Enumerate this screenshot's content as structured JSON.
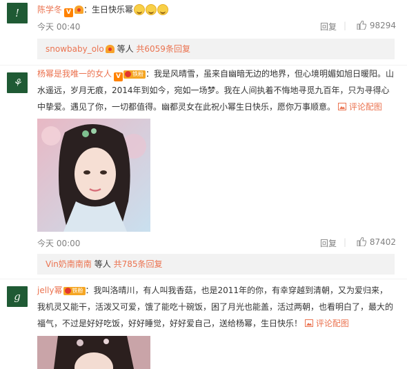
{
  "comments": [
    {
      "avatar_glyph": "!",
      "user": "陈学冬",
      "text": "：生日快乐幂",
      "time": "今天 00:40",
      "reply_label": "回复",
      "likes": "98294",
      "subreply": {
        "user": "snowbaby_olo",
        "middle": "等人",
        "link": "共6059条回复"
      }
    },
    {
      "avatar_glyph": "⚘",
      "user": "杨幂是我唯一的女人",
      "fan_badge": "铁粉",
      "text": "：我是风晴雪，虽来自幽暗无边的地界，但心境明媚如旭日暖阳。山水遥远，岁月无痕，2014年到如今，宛如一场梦。我在人间执着不悔地寻觅九百年，只为寻得心中挚爱。遇见了你，一切都值得。幽都灵女在此祝小幂生日快乐，愿你万事顺意。",
      "pic_comment_label": "评论配图",
      "time": "今天 00:00",
      "reply_label": "回复",
      "likes": "87402",
      "subreply": {
        "user": "Vin奶南南南",
        "middle": "等人",
        "link": "共785条回复"
      }
    },
    {
      "avatar_glyph": "g",
      "user": "jelly幂",
      "fan_badge": "铁粉",
      "text": "：我叫洛晴川，有人叫我香菇，也是2011年的你，有幸穿越到清朝，又为爱归来，我机灵又能干，活泼又可爱，饿了能吃十碗饭，困了月光也能盖，活过两朝，也看明白了，最大的福气，不过是好好吃饭，好好睡觉，好好爱自己，送给杨幂，生日快乐！",
      "pic_comment_label": "评论配图"
    }
  ],
  "colors": {
    "username": "#eb7350",
    "meta": "#808080",
    "subreply_bg": "#f2f2f2"
  }
}
